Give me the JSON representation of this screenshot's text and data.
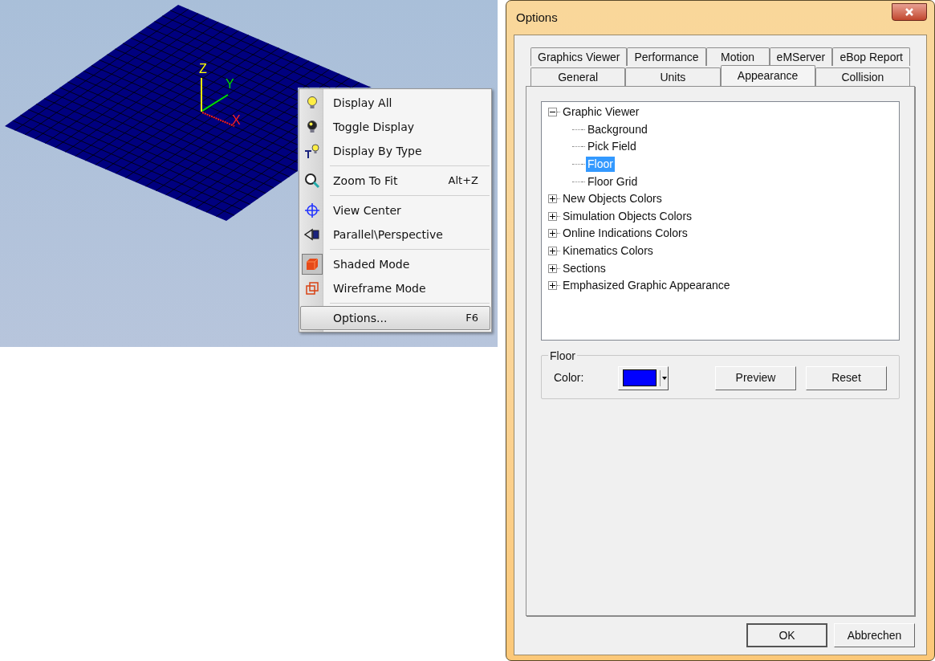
{
  "viewport": {
    "axes": [
      {
        "kind": "z",
        "label": "Z"
      },
      {
        "kind": "y",
        "label": "Y"
      },
      {
        "kind": "x",
        "label": "X"
      }
    ]
  },
  "context_menu": {
    "groups": [
      [
        {
          "kind": "bulb",
          "label": "Display All",
          "checked": false,
          "selected": false
        },
        {
          "kind": "bulb-dark",
          "label": "Toggle Display",
          "checked": false,
          "selected": false
        },
        {
          "kind": "type-bulb",
          "label": "Display By Type",
          "checked": false,
          "selected": false
        }
      ],
      [
        {
          "kind": "zoom",
          "label": "Zoom To Fit",
          "shortcut": "Alt+Z",
          "checked": false,
          "selected": false
        }
      ],
      [
        {
          "kind": "crosshair",
          "label": "View Center",
          "checked": false,
          "selected": false
        },
        {
          "kind": "perspective",
          "label": "Parallel\\Perspective",
          "checked": false,
          "selected": false
        }
      ],
      [
        {
          "kind": "shaded",
          "label": "Shaded Mode",
          "checked": true,
          "selected": false
        },
        {
          "kind": "wireframe",
          "label": "Wireframe Mode",
          "checked": false,
          "selected": false
        }
      ],
      [
        {
          "kind": "plain",
          "label": "Options...",
          "shortcut": "F6",
          "checked": false,
          "selected": true
        }
      ]
    ]
  },
  "dialog": {
    "title": "Options",
    "tab_rows": [
      [
        {
          "label": "Graphics Viewer",
          "selected": false
        },
        {
          "label": "Performance",
          "selected": false
        },
        {
          "label": "Motion",
          "selected": false
        },
        {
          "label": "eMServer",
          "selected": false
        },
        {
          "label": "eBop Report",
          "selected": false
        }
      ],
      [
        {
          "label": "General",
          "selected": false
        },
        {
          "label": "Units",
          "selected": false
        },
        {
          "label": "Appearance",
          "selected": true
        },
        {
          "label": "Collision",
          "selected": false
        }
      ]
    ],
    "tree": [
      {
        "label": "Graphic Viewer",
        "expanded": true,
        "selected": false,
        "children": [
          {
            "label": "Background",
            "selected": false
          },
          {
            "label": "Pick Field",
            "selected": false
          },
          {
            "label": "Floor",
            "selected": true
          },
          {
            "label": "Floor Grid",
            "selected": false
          }
        ]
      },
      {
        "label": "New Objects Colors",
        "expanded": false,
        "selected": false
      },
      {
        "label": "Simulation Objects Colors",
        "expanded": false,
        "selected": false
      },
      {
        "label": "Online Indications Colors",
        "expanded": false,
        "selected": false
      },
      {
        "label": "Kinematics Colors",
        "expanded": false,
        "selected": false
      },
      {
        "label": "Sections",
        "expanded": false,
        "selected": false
      },
      {
        "label": "Emphasized Graphic Appearance",
        "expanded": false,
        "selected": false
      }
    ],
    "group": {
      "title": "Floor",
      "color_label": "Color:",
      "color": "#0000ff",
      "buttons": [
        "Preview",
        "Reset"
      ]
    },
    "footer_buttons": [
      {
        "label": "OK",
        "default": true
      },
      {
        "label": "Abbrechen",
        "default": false
      }
    ]
  }
}
